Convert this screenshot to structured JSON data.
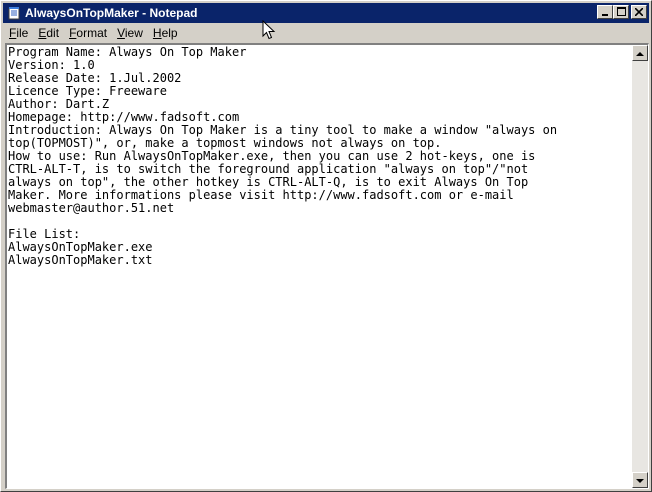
{
  "window": {
    "title": "AlwaysOnTopMaker - Notepad",
    "app_icon": "notepad-icon",
    "title_bar_color": "#0a246a"
  },
  "caption_buttons": {
    "minimize": "minimize-icon",
    "maximize": "maximize-icon",
    "close": "close-icon"
  },
  "menu": {
    "file": {
      "accel": "F",
      "rest": "ile"
    },
    "edit": {
      "accel": "E",
      "rest": "dit"
    },
    "format": {
      "accel": "F",
      "rest": "ormat"
    },
    "view": {
      "accel": "V",
      "rest": "iew"
    },
    "help": {
      "accel": "H",
      "rest": "elp"
    }
  },
  "document": {
    "lines": [
      "Program Name: Always On Top Maker",
      "Version: 1.0",
      "Release Date: 1.Jul.2002",
      "Licence Type: Freeware",
      "Author: Dart.Z",
      "Homepage: http://www.fadsoft.com",
      "Introduction: Always On Top Maker is a tiny tool to make a window \"always on",
      "top(TOPMOST)\", or, make a topmost windows not always on top.",
      "How to use: Run AlwaysOnTopMaker.exe, then you can use 2 hot-keys, one is",
      "CTRL-ALT-T, is to switch the foreground application \"always on top\"/\"not",
      "always on top\", the other hotkey is CTRL-ALT-Q, is to exit Always On Top",
      "Maker. More informations please visit http://www.fadsoft.com or e-mail",
      "webmaster@author.51.net",
      "",
      "File List:",
      "AlwaysOnTopMaker.exe",
      "AlwaysOnTopMaker.txt"
    ]
  },
  "scrollbar": {
    "up_icon": "scroll-up-arrow-icon",
    "down_icon": "scroll-down-arrow-icon"
  },
  "pointer": "mouse-cursor-icon"
}
